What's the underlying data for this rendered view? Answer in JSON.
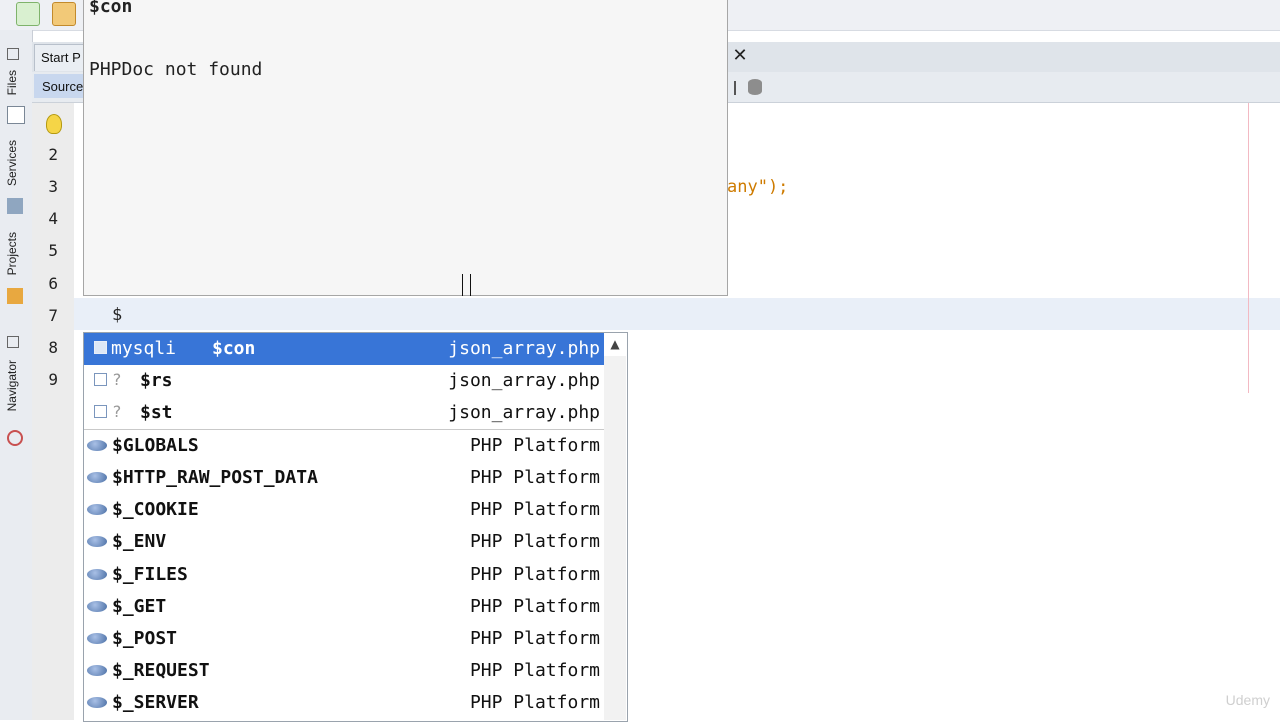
{
  "tabs": {
    "start_page": "Start P",
    "source": "Source"
  },
  "side_panel": {
    "files": "Files",
    "services": "Services",
    "projects": "Projects",
    "navigator": "Navigator"
  },
  "editor": {
    "line_numbers": [
      "2",
      "3",
      "4",
      "5",
      "6",
      "7",
      "8",
      "9"
    ],
    "visible_code_fragment": "any\");",
    "current_line_text": "$"
  },
  "doc_popup": {
    "title": "$con",
    "body": "PHPDoc not found"
  },
  "completion": {
    "items": [
      {
        "type": "mysqli",
        "name": "$con",
        "source": "json_array.php",
        "icon": "variable-icon",
        "selected": true
      },
      {
        "type": "?",
        "name": "$rs",
        "source": "json_array.php",
        "icon": "variable-icon"
      },
      {
        "type": "?",
        "name": "$st",
        "source": "json_array.php",
        "icon": "variable-icon"
      },
      {
        "name": "$GLOBALS",
        "source": "PHP Platform",
        "icon": "php-icon"
      },
      {
        "name": "$HTTP_RAW_POST_DATA",
        "source": "PHP Platform",
        "icon": "php-icon"
      },
      {
        "name": "$_COOKIE",
        "source": "PHP Platform",
        "icon": "php-icon"
      },
      {
        "name": "$_ENV",
        "source": "PHP Platform",
        "icon": "php-icon"
      },
      {
        "name": "$_FILES",
        "source": "PHP Platform",
        "icon": "php-icon"
      },
      {
        "name": "$_GET",
        "source": "PHP Platform",
        "icon": "php-icon"
      },
      {
        "name": "$_POST",
        "source": "PHP Platform",
        "icon": "php-icon"
      },
      {
        "name": "$_REQUEST",
        "source": "PHP Platform",
        "icon": "php-icon"
      },
      {
        "name": "$_SERVER",
        "source": "PHP Platform",
        "icon": "php-icon"
      }
    ]
  },
  "watermark": "Udemy",
  "colors": {
    "selection": "#3875d7",
    "string_literal": "#ce7b00",
    "current_line": "#e9eff8"
  }
}
